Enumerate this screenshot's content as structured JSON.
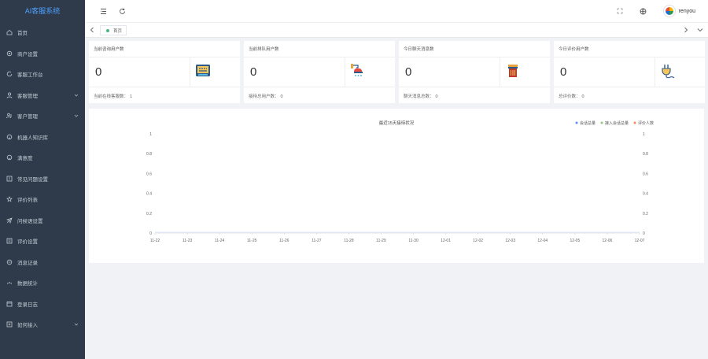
{
  "app": {
    "logo_text": "AI客服系统"
  },
  "sidebar": {
    "items": [
      {
        "label": "首页",
        "icon": "home-icon",
        "has_children": false
      },
      {
        "label": "商户设置",
        "icon": "gear-icon",
        "has_children": false
      },
      {
        "label": "客服工作台",
        "icon": "refresh-icon",
        "has_children": false
      },
      {
        "label": "客服管理",
        "icon": "user-icon",
        "has_children": true
      },
      {
        "label": "客户管理",
        "icon": "group-icon",
        "has_children": true
      },
      {
        "label": "机器人知识库",
        "icon": "robot-icon",
        "has_children": false
      },
      {
        "label": "满意度",
        "icon": "smile-icon",
        "has_children": false
      },
      {
        "label": "常见问题设置",
        "icon": "question-icon",
        "has_children": false
      },
      {
        "label": "评价列表",
        "icon": "star-icon",
        "has_children": false
      },
      {
        "label": "问候语设置",
        "icon": "send-icon",
        "has_children": false
      },
      {
        "label": "评价设置",
        "icon": "list-icon",
        "has_children": false
      },
      {
        "label": "消息记录",
        "icon": "message-icon",
        "has_children": false
      },
      {
        "label": "数据统计",
        "icon": "chart-icon",
        "has_children": false
      },
      {
        "label": "登录日志",
        "icon": "calendar-icon",
        "has_children": false
      },
      {
        "label": "如何接入",
        "icon": "link-icon",
        "has_children": true
      }
    ]
  },
  "topbar": {
    "username": "renyou"
  },
  "tabs": [
    {
      "label": "首页",
      "active": true
    }
  ],
  "stats": [
    {
      "title": "当前咨询用户数",
      "value": "0",
      "foot_label": "当前在线客服数：",
      "foot_value": "1",
      "icon": "chat-bubble-icon"
    },
    {
      "title": "当前排队用户数",
      "value": "0",
      "foot_label": "接待总用户数：",
      "foot_value": "0",
      "icon": "watering-icon"
    },
    {
      "title": "今日聊天消息数",
      "value": "0",
      "foot_label": "聊天消息总数：",
      "foot_value": "0",
      "icon": "trash-icon"
    },
    {
      "title": "今日评价用户数",
      "value": "0",
      "foot_label": "总评价数：",
      "foot_value": "0",
      "icon": "plug-icon"
    }
  ],
  "chart_data": {
    "type": "line",
    "title": "最近15天接待状况",
    "categories": [
      "11-22",
      "11-23",
      "11-24",
      "11-25",
      "11-26",
      "11-27",
      "11-28",
      "11-29",
      "11-30",
      "12-01",
      "12-02",
      "12-03",
      "12-04",
      "12-05",
      "12-06",
      "12-07"
    ],
    "series": [
      {
        "name": "会话总量",
        "color": "#5b8ff9",
        "values": [
          0,
          0,
          0,
          0,
          0,
          0,
          0,
          0,
          0,
          0,
          0,
          0,
          0,
          0,
          0,
          0
        ]
      },
      {
        "name": "接入会话总量",
        "color": "#91cc75",
        "values": [
          0,
          0,
          0,
          0,
          0,
          0,
          0,
          0,
          0,
          0,
          0,
          0,
          0,
          0,
          0,
          0
        ]
      },
      {
        "name": "评价人数",
        "color": "#f08a5d",
        "values": [
          0,
          0,
          0,
          0,
          0,
          0,
          0,
          0,
          0,
          0,
          0,
          0,
          0,
          0,
          0,
          0
        ]
      }
    ],
    "yticks": [
      "0",
      "0.2",
      "0.4",
      "0.6",
      "0.8",
      "1"
    ],
    "ylim": [
      0,
      1
    ],
    "legend": "top-right"
  }
}
